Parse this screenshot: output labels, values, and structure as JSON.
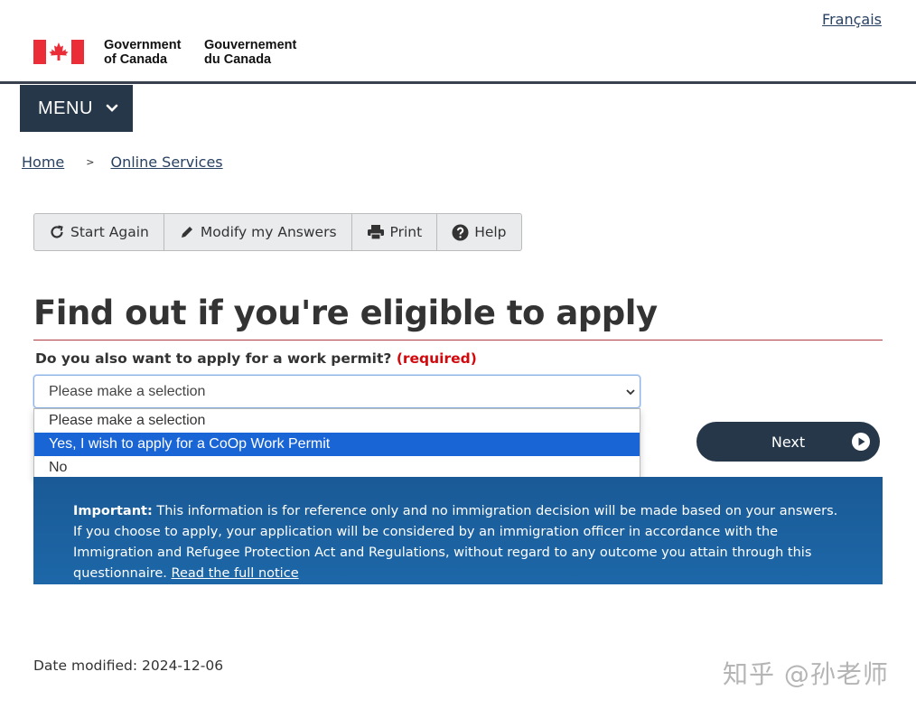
{
  "header": {
    "lang_link": "Français",
    "gov_en_line1": "Government",
    "gov_en_line2": "of Canada",
    "gov_fr_line1": "Gouvernement",
    "gov_fr_line2": "du Canada"
  },
  "menu": {
    "label": "MENU"
  },
  "breadcrumb": {
    "items": [
      "Home",
      "Online Services"
    ],
    "separator": ">"
  },
  "toolbar": {
    "start_again": "Start Again",
    "modify": "Modify my Answers",
    "print": "Print",
    "help": "Help"
  },
  "page": {
    "title": "Find out if you're eligible to apply"
  },
  "question": {
    "label": "Do you also want to apply for a work permit?",
    "required": "(required)",
    "select_value": "Please make a selection",
    "options": [
      "Please make a selection",
      "Yes, I wish to apply for a CoOp Work Permit",
      "No"
    ],
    "highlighted_option": "Yes, I wish to apply for a CoOp Work Permit"
  },
  "next_button": {
    "label": "Next"
  },
  "notice": {
    "lead": "Important:",
    "text": " This information is for reference only and no immigration decision will be made based on your answers. If you choose to apply, your application will be considered by an immigration officer in accordance with the Immigration and Refugee Protection Act and Regulations, without regard to any outcome you attain through this questionnaire. ",
    "link": "Read the full notice"
  },
  "footer": {
    "date_modified": "Date modified: 2024-12-06"
  },
  "watermark": "知乎 @孙老师",
  "colors": {
    "navy": "#26374a",
    "link": "#284162",
    "required": "#d3080c",
    "notice_bg": "#1d67a8",
    "selected_option": "#1a65d6",
    "flag_red": "#eb2d37"
  }
}
